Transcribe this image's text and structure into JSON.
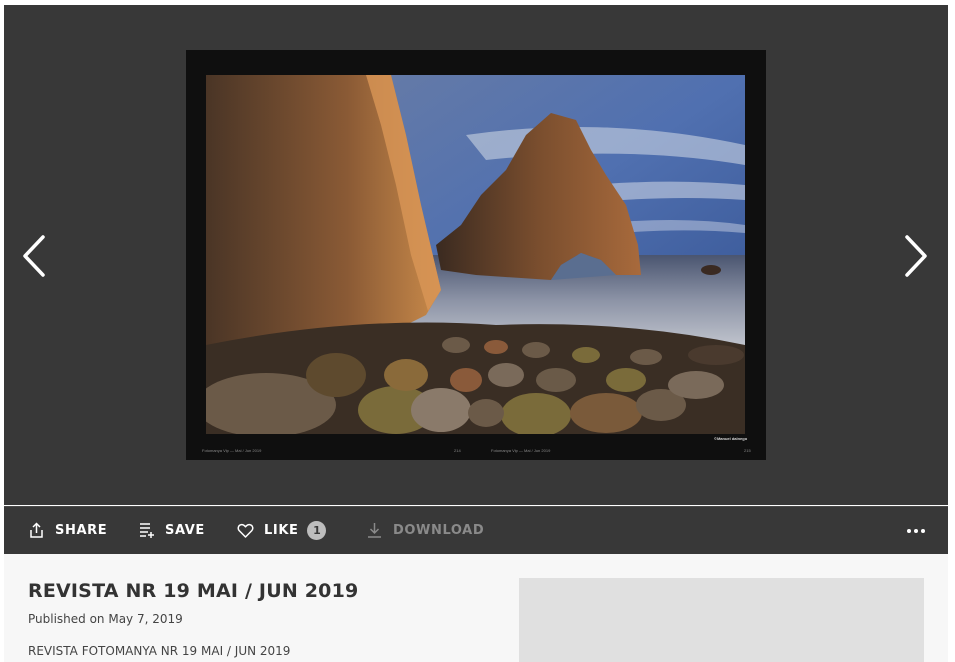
{
  "viewer": {
    "page_left_footer": "Fotomanya Vip — Mai / Jun 2019",
    "page_left_number": "214",
    "page_right_footer": "Fotomanya Vip — Mai / Jun 2019",
    "page_right_number": "215",
    "photo_credit": "©Manuel dalnego",
    "prev_icon": "chevron-left-icon",
    "next_icon": "chevron-right-icon"
  },
  "toolbar": {
    "share_label": "SHARE",
    "save_label": "SAVE",
    "like_label": "LIKE",
    "like_count": "1",
    "download_label": "DOWNLOAD",
    "more_icon": "more-horizontal-icon"
  },
  "document": {
    "title": "REVISTA NR 19 MAI / JUN 2019",
    "published": "Published on May 7, 2019",
    "description": "REVISTA FOTOMANYA NR 19 MAI / JUN 2019"
  },
  "colors": {
    "viewer_bg": "#383838",
    "info_bg": "#f7f7f7",
    "badge_bg": "#bdbdbd",
    "disabled_text": "#8a8a8a"
  }
}
